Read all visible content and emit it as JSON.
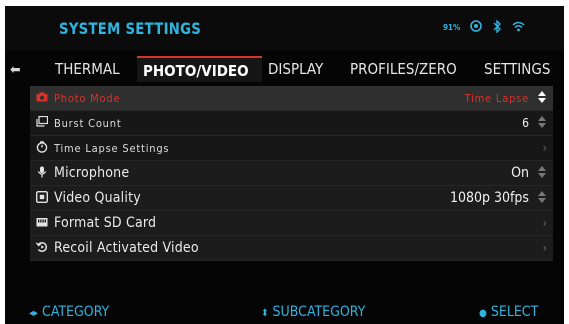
{
  "header": {
    "title": "SYSTEM SETTINGS",
    "battery_text": "91%",
    "status_icons": [
      "battery-icon",
      "target-icon",
      "bluetooth-icon",
      "wifi-icon"
    ]
  },
  "tabs": [
    {
      "label": "THERMAL",
      "active": false
    },
    {
      "label": "PHOTO/VIDEO",
      "active": true
    },
    {
      "label": "DISPLAY",
      "active": false
    },
    {
      "label": "PROFILES/ZERO",
      "active": false
    },
    {
      "label": "SETTINGS",
      "active": false
    }
  ],
  "menu": {
    "items": [
      {
        "label": "Photo Mode",
        "value": "Time Lapse",
        "icon": "camera-icon",
        "control": "up-down-arrows",
        "selected": true
      },
      {
        "label": "Burst Count",
        "value": "6",
        "icon": "burst-icon",
        "control": "up-down-arrows"
      },
      {
        "label": "Time Lapse Settings",
        "value": "",
        "icon": "timer-icon",
        "control": "chevron-right"
      },
      {
        "label": "Microphone",
        "value": "On",
        "icon": "microphone-icon",
        "control": "up-down-arrows"
      },
      {
        "label": "Video Quality",
        "value": "1080p 30fps",
        "icon": "video-quality-icon",
        "control": "up-down-arrows"
      },
      {
        "label": "Format SD Card",
        "value": "",
        "icon": "sd-card-icon",
        "control": "chevron-right"
      },
      {
        "label": "Recoil Activated Video",
        "value": "",
        "icon": "recoil-video-icon",
        "control": "chevron-right"
      }
    ]
  },
  "footer": {
    "category": "CATEGORY",
    "subcategory": "SUBCATEGORY",
    "select": "SELECT"
  },
  "colors": {
    "accent_blue": "#2fb4e0",
    "accent_red": "#d8332b",
    "background": "#050505"
  }
}
